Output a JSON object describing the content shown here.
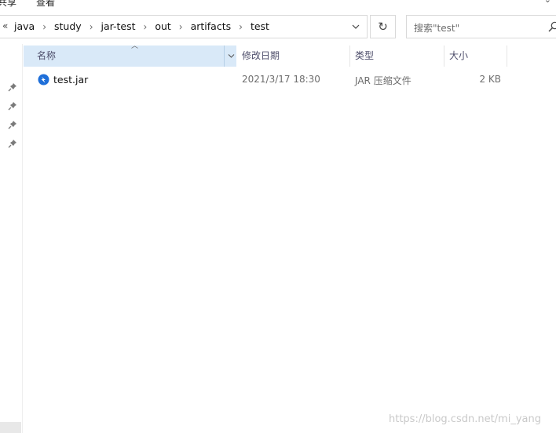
{
  "ribbon": {
    "tabs": [
      "共享",
      "查看"
    ]
  },
  "address": {
    "overflow": "«",
    "breadcrumbs": [
      "java",
      "study",
      "jar-test",
      "out",
      "artifacts",
      "test"
    ]
  },
  "search": {
    "placeholder": "搜索\"test\""
  },
  "columns": {
    "name": "名称",
    "date_modified": "修改日期",
    "type": "类型",
    "size": "大小"
  },
  "files": [
    {
      "name": "test.jar",
      "date_modified": "2021/3/17 18:30",
      "type": "JAR 压缩文件",
      "size": "2 KB",
      "icon": "jar-file-icon"
    }
  ],
  "watermark": "https://blog.csdn.net/mi_yang",
  "colors": {
    "header_selected": "#d9e9f8",
    "file_icon": "#1e6fd9"
  }
}
